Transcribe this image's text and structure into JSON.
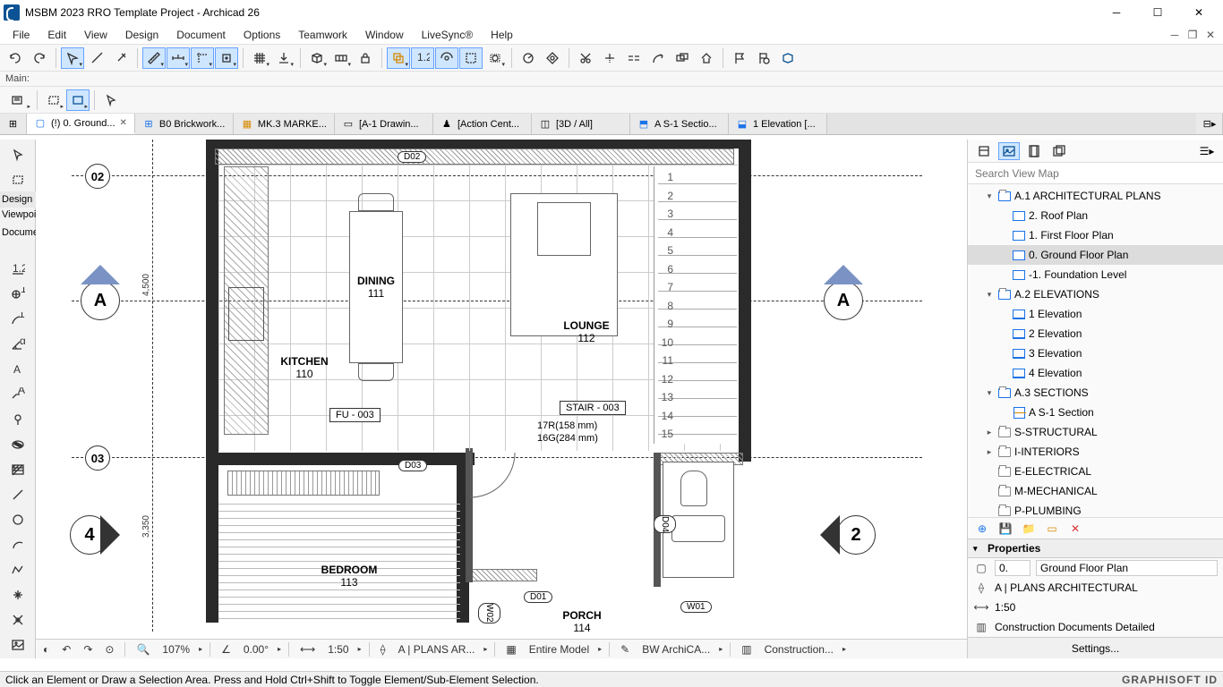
{
  "title": "MSBM 2023 RRO Template Project - Archicad 26",
  "menu": [
    "File",
    "Edit",
    "View",
    "Design",
    "Document",
    "Options",
    "Teamwork",
    "Window",
    "LiveSync®",
    "Help"
  ],
  "mainLabel": "Main:",
  "tabs": [
    {
      "icon": "plan",
      "label": "(!) 0. Ground...",
      "active": true,
      "close": true
    },
    {
      "icon": "worksheet",
      "label": "B0 Brickwork..."
    },
    {
      "icon": "schedule",
      "label": "MK.3 MARKE..."
    },
    {
      "icon": "layout",
      "label": "[A-1 Drawin..."
    },
    {
      "icon": "detail",
      "label": "[Action Cent..."
    },
    {
      "icon": "3d",
      "label": "[3D / All]"
    },
    {
      "icon": "section",
      "label": "A S-1 Sectio..."
    },
    {
      "icon": "elevation",
      "label": "1 Elevation [..."
    }
  ],
  "leftLabels": {
    "design": "Design",
    "viewpoi": "Viewpoi",
    "docume": "Docume"
  },
  "search": {
    "placeholder": "Search View Map"
  },
  "tree": [
    {
      "lvl": 1,
      "chev": "v",
      "icon": "folder-blue",
      "label": "A.1 ARCHITECTURAL PLANS"
    },
    {
      "lvl": 2,
      "icon": "plan",
      "label": "2. Roof Plan"
    },
    {
      "lvl": 2,
      "icon": "plan",
      "label": "1. First Floor Plan"
    },
    {
      "lvl": 2,
      "icon": "plan",
      "label": "0. Ground Floor Plan",
      "selected": true
    },
    {
      "lvl": 2,
      "icon": "plan",
      "label": "-1. Foundation Level"
    },
    {
      "lvl": 1,
      "chev": "v",
      "icon": "folder-blue",
      "label": "A.2 ELEVATIONS"
    },
    {
      "lvl": 2,
      "icon": "elev",
      "label": "1 Elevation"
    },
    {
      "lvl": 2,
      "icon": "elev",
      "label": "2 Elevation"
    },
    {
      "lvl": 2,
      "icon": "elev",
      "label": "3 Elevation"
    },
    {
      "lvl": 2,
      "icon": "elev",
      "label": "4 Elevation"
    },
    {
      "lvl": 1,
      "chev": "v",
      "icon": "folder-blue",
      "label": "A.3 SECTIONS"
    },
    {
      "lvl": 2,
      "icon": "section",
      "label": "A S-1 Section"
    },
    {
      "lvl": 1,
      "chev": ">",
      "icon": "folder",
      "label": "S-STRUCTURAL"
    },
    {
      "lvl": 1,
      "chev": ">",
      "icon": "folder",
      "label": "I-INTERIORS"
    },
    {
      "lvl": 1,
      "chev": "",
      "icon": "folder",
      "label": "E-ELECTRICAL"
    },
    {
      "lvl": 1,
      "chev": "",
      "icon": "folder",
      "label": "M-MECHANICAL"
    },
    {
      "lvl": 1,
      "chev": "",
      "icon": "folder",
      "label": "P-PLUMBING"
    }
  ],
  "properties": {
    "header": "Properties",
    "id": "0.",
    "name": "Ground Floor Plan",
    "layer": "A | PLANS ARCHITECTURAL",
    "scale": "1:50",
    "mvo": "Construction Documents Detailed",
    "settings": "Settings..."
  },
  "quickbar": {
    "zoom": "107%",
    "angle": "0.00°",
    "scale": "1:50",
    "layer": "A | PLANS AR...",
    "model": "Entire Model",
    "pen": "BW ArchiCA...",
    "mvo": "Construction..."
  },
  "status": "Click an Element or Draw a Selection Area. Press and Hold Ctrl+Shift to Toggle Element/Sub-Element Selection.",
  "graphisoft": "GRAPHISOFT ID",
  "rooms": {
    "dining": {
      "name": "DINING",
      "num": "111"
    },
    "kitchen": {
      "name": "KITCHEN",
      "num": "110"
    },
    "lounge": {
      "name": "LOUNGE",
      "num": "112"
    },
    "bedroom": {
      "name": "BEDROOM",
      "num": "113"
    },
    "porch": {
      "name": "PORCH",
      "num": "114"
    }
  },
  "tags": {
    "fu": "FU - 003",
    "stair": "STAIR - 003",
    "stair_r": "17R(158 mm)",
    "stair_g": "16G(284 mm)",
    "d02": "D02",
    "d03": "D03",
    "d04": "D04",
    "d01": "D01",
    "w01": "W01",
    "w02": "W02"
  },
  "dims": {
    "d1": "4,500",
    "d2": "3,350"
  },
  "markers": {
    "a": "A",
    "m02": "02",
    "m03": "03",
    "m4": "4",
    "m2": "2"
  },
  "stair_nums": [
    "1",
    "2",
    "3",
    "4",
    "5",
    "6",
    "7",
    "8",
    "9",
    "10",
    "11",
    "12",
    "13",
    "14",
    "15"
  ]
}
